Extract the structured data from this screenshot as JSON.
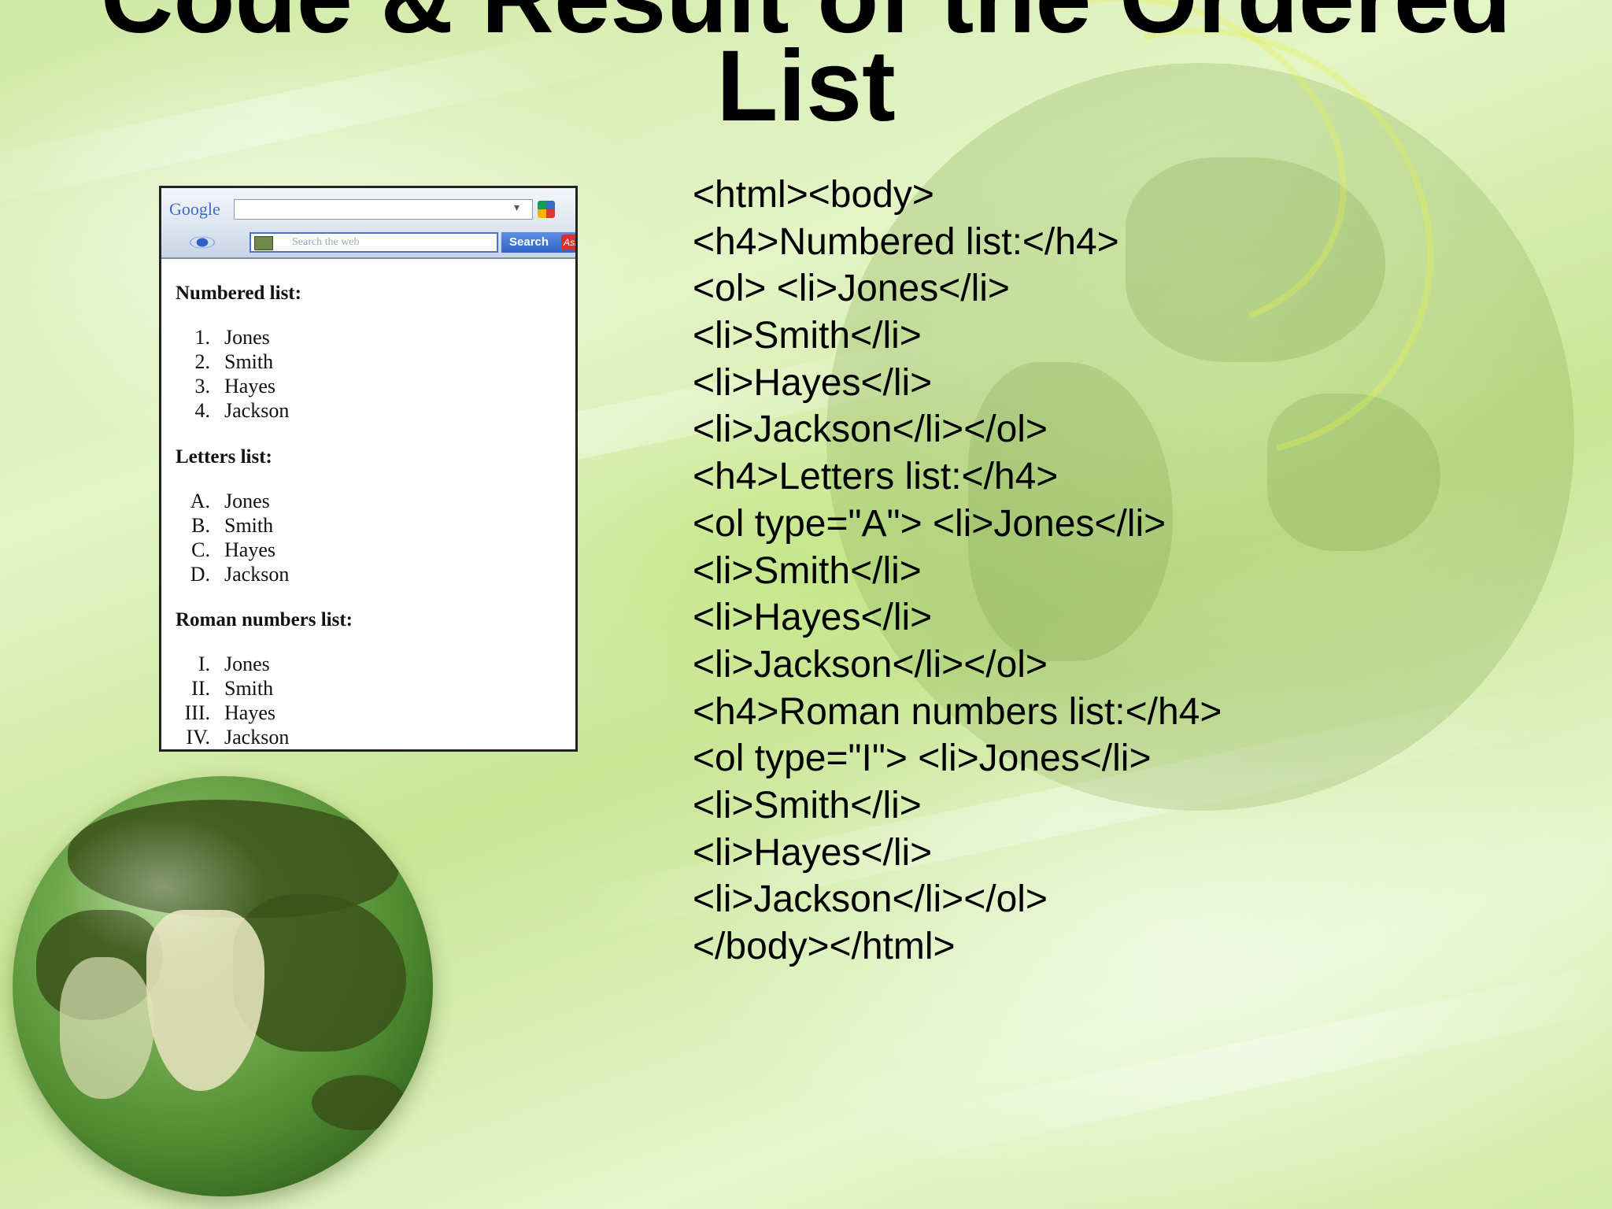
{
  "slide": {
    "title_line1": "Code & Result of the Ordered",
    "title_line2": "List"
  },
  "browser_screenshot": {
    "toolbar": {
      "logo_text": "Google",
      "search_placeholder": "Search the web",
      "search_button": "Search",
      "ask_badge": "Ask"
    },
    "sections": [
      {
        "heading": "Numbered list:",
        "items": [
          {
            "marker": "1.",
            "text": "Jones"
          },
          {
            "marker": "2.",
            "text": "Smith"
          },
          {
            "marker": "3.",
            "text": "Hayes"
          },
          {
            "marker": "4.",
            "text": "Jackson"
          }
        ]
      },
      {
        "heading": "Letters list:",
        "items": [
          {
            "marker": "A.",
            "text": "Jones"
          },
          {
            "marker": "B.",
            "text": "Smith"
          },
          {
            "marker": "C.",
            "text": "Hayes"
          },
          {
            "marker": "D.",
            "text": "Jackson"
          }
        ]
      },
      {
        "heading": "Roman numbers list:",
        "items": [
          {
            "marker": "I.",
            "text": "Jones"
          },
          {
            "marker": "II.",
            "text": "Smith"
          },
          {
            "marker": "III.",
            "text": "Hayes"
          },
          {
            "marker": "IV.",
            "text": "Jackson"
          }
        ]
      }
    ]
  },
  "code_lines": [
    "<html><body>",
    "<h4>Numbered list:</h4>",
    "<ol> <li>Jones</li>",
    "<li>Smith</li>",
    "<li>Hayes</li>",
    "<li>Jackson</li></ol>",
    "<h4>Letters list:</h4>",
    "<ol type=\"A\"> <li>Jones</li>",
    "<li>Smith</li>",
    "<li>Hayes</li>",
    "<li>Jackson</li></ol>",
    "<h4>Roman numbers list:</h4>",
    "<ol type=\"I\"> <li>Jones</li>",
    "<li>Smith</li>",
    "<li>Hayes</li>",
    "<li>Jackson</li></ol>",
    "</body></html>"
  ]
}
